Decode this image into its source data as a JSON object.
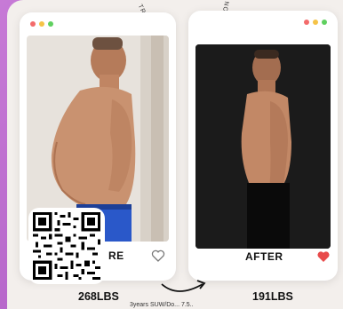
{
  "before": {
    "label": "RE",
    "weight": "268LBS"
  },
  "after": {
    "label": "AFTER",
    "weight": "191LBS"
  },
  "vertical_text_left": "TRA",
  "vertical_text_right": "NOI",
  "caption": "3years SUW/Do... 7.5..",
  "colors": {
    "background": "#b565c9",
    "heart_after": "#e84a4a",
    "heart_before_outline": "#777777"
  },
  "icons": [
    "heart-outline-icon",
    "heart-filled-icon",
    "arrow-icon",
    "qr-code"
  ]
}
